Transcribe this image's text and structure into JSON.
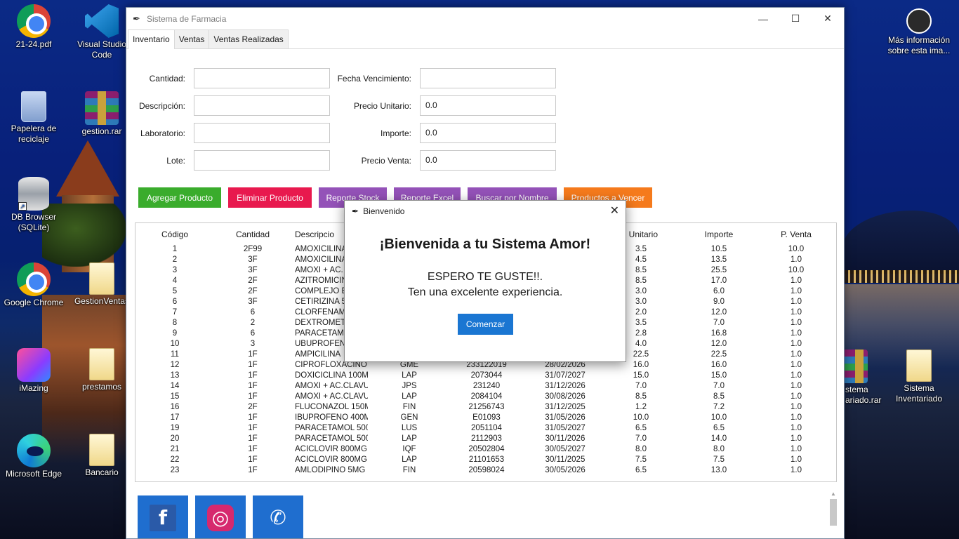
{
  "desktop": {
    "left_icons": [
      {
        "label": "21-24.pdf",
        "icon": "chrome-icon"
      },
      {
        "label": "Visual Studio Code",
        "icon": "vscode-icon"
      },
      {
        "label": "Papelera de reciclaje",
        "icon": "recycle-bin-icon"
      },
      {
        "label": "gestion.rar",
        "icon": "winrar-icon"
      },
      {
        "label": "DB Browser (SQLite)",
        "icon": "database-icon"
      },
      {
        "label": "Google Chrome",
        "icon": "chrome-icon"
      },
      {
        "label": "GestionVentas",
        "icon": "folder-icon"
      },
      {
        "label": "iMazing",
        "icon": "imazing-icon"
      },
      {
        "label": "prestamos",
        "icon": "folder-icon"
      },
      {
        "label": "Microsoft Edge",
        "icon": "edge-icon"
      },
      {
        "label": "Bancario",
        "icon": "folder-icon"
      }
    ],
    "right_icons": [
      {
        "label": "Más información sobre esta ima...",
        "icon": "info-camera-icon"
      },
      {
        "label": "stema ariado.rar",
        "icon": "winrar-icon"
      },
      {
        "label": "Sistema Inventariado",
        "icon": "folder-icon"
      }
    ]
  },
  "window": {
    "title": "Sistema de Farmacia",
    "controls": {
      "minimize": "—",
      "maximize": "☐",
      "close": "✕"
    }
  },
  "tabs": [
    "Inventario",
    "Ventas",
    "Ventas Realizadas"
  ],
  "form": {
    "cantidad_label": "Cantidad:",
    "cantidad_value": "",
    "descripcion_label": "Descripción:",
    "descripcion_value": "",
    "laboratorio_label": "Laboratorio:",
    "laboratorio_value": "",
    "lote_label": "Lote:",
    "lote_value": "",
    "fecha_label": "Fecha Vencimiento:",
    "fecha_value": "",
    "precio_unitario_label": "Precio Unitario:",
    "precio_unitario_value": "0.0",
    "importe_label": "Importe:",
    "importe_value": "0.0",
    "precio_venta_label": "Precio Venta:",
    "precio_venta_value": "0.0"
  },
  "actions": [
    {
      "label": "Agregar Producto",
      "color": "#3aac2c"
    },
    {
      "label": "Eliminar Producto",
      "color": "#e8194e"
    },
    {
      "label": "Reporte Stock",
      "color": "#9452b8"
    },
    {
      "label": "Reporte Excel",
      "color": "#9452b8"
    },
    {
      "label": "Buscar por Nombre",
      "color": "#9452b8"
    },
    {
      "label": "Productos a Vencer",
      "color": "#f57a1c"
    }
  ],
  "table": {
    "headers": [
      "Código",
      "Cantidad",
      "Descripcio",
      "",
      "",
      "",
      ". Unitario",
      "Importe",
      "P. Venta"
    ],
    "rows": [
      [
        "1",
        "2F99",
        "AMOXICILINA",
        "",
        "",
        "",
        "3.5",
        "10.5",
        "10.0"
      ],
      [
        "2",
        "3F",
        "AMOXICILINA",
        "",
        "",
        "",
        "4.5",
        "13.5",
        "1.0"
      ],
      [
        "3",
        "3F",
        "AMOXI + AC.",
        "",
        "",
        "",
        "8.5",
        "25.5",
        "10.0"
      ],
      [
        "4",
        "2F",
        "AZITROMICIN",
        "",
        "",
        "",
        "8.5",
        "17.0",
        "1.0"
      ],
      [
        "5",
        "2F",
        "COMPLEJO B",
        "",
        "",
        "",
        "3.0",
        "6.0",
        "1.0"
      ],
      [
        "6",
        "3F",
        "CETIRIZINA 5",
        "",
        "",
        "",
        "3.0",
        "9.0",
        "1.0"
      ],
      [
        "7",
        "6",
        "CLORFENAMI",
        "",
        "",
        "",
        "2.0",
        "12.0",
        "1.0"
      ],
      [
        "8",
        "2",
        "DEXTROMETO",
        "",
        "",
        "",
        "3.5",
        "7.0",
        "1.0"
      ],
      [
        "9",
        "6",
        "PARACETAMO",
        "",
        "",
        "",
        "2.8",
        "16.8",
        "1.0"
      ],
      [
        "10",
        "3",
        "UBUPROFENO",
        "",
        "",
        "",
        "4.0",
        "12.0",
        "1.0"
      ],
      [
        "11",
        "1F",
        "AMPICILINA",
        "",
        "",
        "",
        "22.5",
        "22.5",
        "1.0"
      ],
      [
        "12",
        "1F",
        "CIPROFLOXACINO",
        "GME",
        "233122019",
        "28/02/2026",
        "16.0",
        "16.0",
        "1.0"
      ],
      [
        "13",
        "1F",
        "DOXICICLINA 100M",
        "LAP",
        "2073044",
        "31/07/2027",
        "15.0",
        "15.0",
        "1.0"
      ],
      [
        "14",
        "1F",
        "AMOXI + AC.CLAVU",
        "JPS",
        "231240",
        "31/12/2026",
        "7.0",
        "7.0",
        "1.0"
      ],
      [
        "15",
        "1F",
        "AMOXI + AC.CLAVU",
        "LAP",
        "2084104",
        "30/08/2026",
        "8.5",
        "8.5",
        "1.0"
      ],
      [
        "16",
        "2F",
        "FLUCONAZOL 150M",
        "FIN",
        "21256743",
        "31/12/2025",
        "1.2",
        "7.2",
        "1.0"
      ],
      [
        "17",
        "1F",
        "IBUPROFENO 400M",
        "GEN",
        "E01093",
        "31/05/2026",
        "10.0",
        "10.0",
        "1.0"
      ],
      [
        "19",
        "1F",
        "PARACETAMOL 500",
        "LUS",
        "2051104",
        "31/05/2027",
        "6.5",
        "6.5",
        "1.0"
      ],
      [
        "20",
        "1F",
        "PARACETAMOL 500",
        "LAP",
        "2112903",
        "30/11/2026",
        "7.0",
        "14.0",
        "1.0"
      ],
      [
        "21",
        "1F",
        "ACICLOVIR 800MG",
        "IQF",
        "20502804",
        "30/05/2027",
        "8.0",
        "8.0",
        "1.0"
      ],
      [
        "22",
        "1F",
        "ACICLOVIR 800MG",
        "LAP",
        "21101653",
        "30/11/2025",
        "7.5",
        "7.5",
        "1.0"
      ],
      [
        "23",
        "1F",
        "AMLODIPINO 5MG",
        "FIN",
        "20598024",
        "30/05/2026",
        "6.5",
        "13.0",
        "1.0"
      ]
    ]
  },
  "social": [
    {
      "name": "facebook-icon",
      "glyph": "f",
      "bg": "#1f6ecf",
      "inner": "#2a5aa8"
    },
    {
      "name": "instagram-icon",
      "glyph": "◎",
      "bg": "#1f6ecf",
      "inner": "#d6296e"
    },
    {
      "name": "whatsapp-icon",
      "glyph": "✆",
      "bg": "#1f6ecf",
      "inner": "#1f6ecf"
    }
  ],
  "modal": {
    "title": "Bienvenido",
    "heading": "¡Bienvenida a tu Sistema Amor!",
    "line1": "ESPERO TE GUSTE!!.",
    "line2": "Ten una excelente experiencia.",
    "button": "Comenzar",
    "close": "✕"
  }
}
